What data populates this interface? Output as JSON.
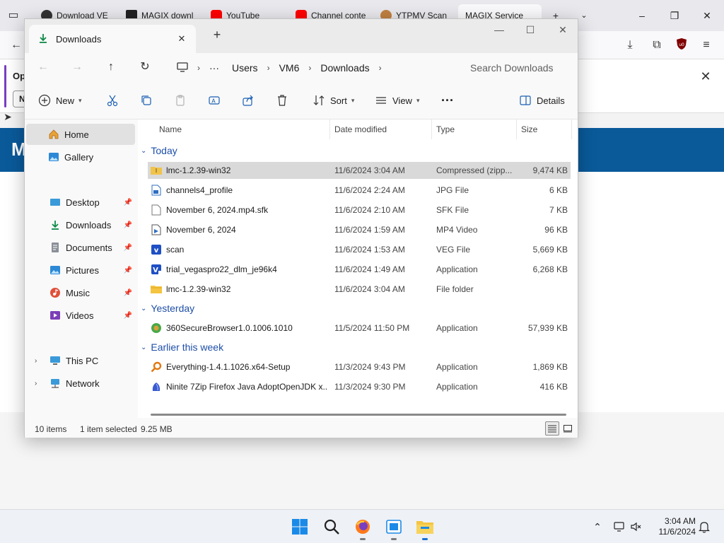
{
  "browser": {
    "tabs": [
      {
        "label": "Download VE",
        "color": "#333333"
      },
      {
        "label": "MAGIX downl",
        "color": "#222222"
      },
      {
        "label": "YouTube",
        "color": "#ff0000"
      },
      {
        "label": "Channel conte",
        "color": "#ff0000"
      },
      {
        "label": "YTPMV Scan",
        "color": "#c08040"
      },
      {
        "label": "MAGIX Service",
        "color": "#0a5a9a"
      }
    ],
    "notification": {
      "text": "Op",
      "button": "N"
    },
    "site_logo": "M"
  },
  "explorer": {
    "tab_title": "Downloads",
    "breadcrumb": [
      "Users",
      "VM6",
      "Downloads"
    ],
    "search_placeholder": "Search Downloads",
    "toolbar": {
      "new": "New",
      "sort": "Sort",
      "view": "View",
      "details": "Details"
    },
    "sidebar": {
      "home": "Home",
      "gallery": "Gallery",
      "desktop": "Desktop",
      "downloads": "Downloads",
      "documents": "Documents",
      "pictures": "Pictures",
      "music": "Music",
      "videos": "Videos",
      "this_pc": "This PC",
      "network": "Network"
    },
    "columns": {
      "name": "Name",
      "date": "Date modified",
      "type": "Type",
      "size": "Size"
    },
    "groups": {
      "today": {
        "label": "Today",
        "rows": [
          {
            "name": "lmc-1.2.39-win32",
            "date": "11/6/2024 3:04 AM",
            "type": "Compressed (zipp...",
            "size": "9,474 KB",
            "icon": "zip-folder-icon"
          },
          {
            "name": "channels4_profile",
            "date": "11/6/2024 2:24 AM",
            "type": "JPG File",
            "size": "6 KB",
            "icon": "image-file-icon"
          },
          {
            "name": "November 6, 2024.mp4.sfk",
            "date": "11/6/2024 2:10 AM",
            "type": "SFK File",
            "size": "7 KB",
            "icon": "blank-file-icon"
          },
          {
            "name": "November 6, 2024",
            "date": "11/6/2024 1:59 AM",
            "type": "MP4 Video",
            "size": "96 KB",
            "icon": "video-file-icon"
          },
          {
            "name": "scan",
            "date": "11/6/2024 1:53 AM",
            "type": "VEG File",
            "size": "5,669 KB",
            "icon": "vegas-file-icon"
          },
          {
            "name": "trial_vegaspro22_dlm_je96k4",
            "date": "11/6/2024 1:49 AM",
            "type": "Application",
            "size": "6,268 KB",
            "icon": "vegas-app-icon"
          },
          {
            "name": "lmc-1.2.39-win32",
            "date": "11/6/2024 3:04 AM",
            "type": "File folder",
            "size": "",
            "icon": "folder-icon"
          }
        ]
      },
      "yesterday": {
        "label": "Yesterday",
        "rows": [
          {
            "name": "360SecureBrowser1.0.1006.1010",
            "date": "11/5/2024 11:50 PM",
            "type": "Application",
            "size": "57,939 KB",
            "icon": "installer-icon"
          }
        ]
      },
      "earlier": {
        "label": "Earlier this week",
        "rows": [
          {
            "name": "Everything-1.4.1.1026.x64-Setup",
            "date": "11/3/2024 9:43 PM",
            "type": "Application",
            "size": "1,869 KB",
            "icon": "search-app-icon"
          },
          {
            "name": "Ninite 7Zip Firefox Java AdoptOpenJDK x...",
            "date": "11/3/2024 9:30 PM",
            "type": "Application",
            "size": "416 KB",
            "icon": "ninite-icon"
          }
        ]
      }
    },
    "status": {
      "items": "10 items",
      "selected": "1 item selected",
      "size": "9.25 MB"
    }
  },
  "taskbar": {
    "time": "3:04 AM",
    "date": "11/6/2024"
  }
}
